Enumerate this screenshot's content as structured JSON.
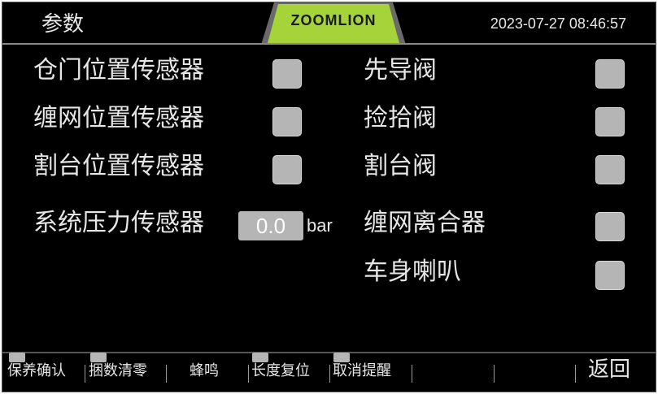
{
  "header": {
    "title": "参数",
    "brand": "ZOOMLION",
    "datetime": "2023-07-27 08:46:57",
    "brand_color": "#a6d33a"
  },
  "left_items": [
    {
      "label": "仓门位置传感器"
    },
    {
      "label": "缠网位置传感器"
    },
    {
      "label": "割台位置传感器"
    }
  ],
  "pressure": {
    "label": "系统压力传感器",
    "value": "0.0",
    "unit": "bar"
  },
  "right_items": [
    {
      "label": "先导阀"
    },
    {
      "label": "捡拾阀"
    },
    {
      "label": "割台阀"
    },
    {
      "label": "缠网离合器"
    },
    {
      "label": "车身喇叭"
    }
  ],
  "footer": {
    "keys": [
      {
        "label": "保养确认"
      },
      {
        "label": "捆数清零"
      },
      {
        "label": "蜂鸣"
      },
      {
        "label": "长度复位"
      },
      {
        "label": "取消提醒"
      }
    ],
    "back_label": "返回"
  },
  "colors": {
    "indicator_off": "#b5b5b5",
    "background": "#000000"
  }
}
